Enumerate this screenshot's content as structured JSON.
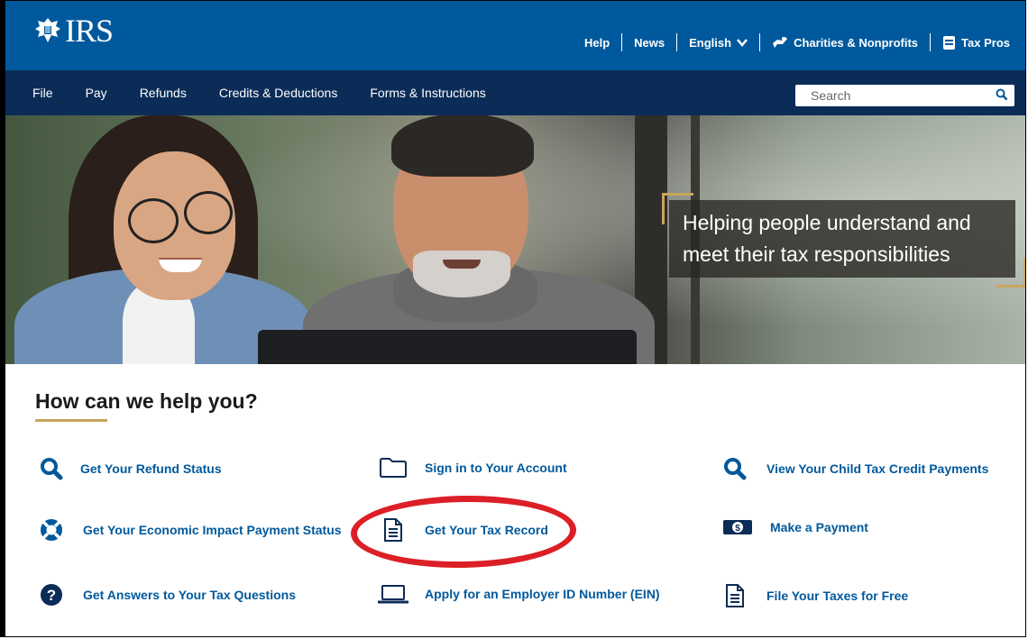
{
  "brand": {
    "wordmark": "IRS"
  },
  "utility_nav": {
    "help": "Help",
    "news": "News",
    "language": "English",
    "charities": "Charities & Nonprofits",
    "tax_pros": "Tax Pros"
  },
  "main_nav": {
    "items": [
      "File",
      "Pay",
      "Refunds",
      "Credits & Deductions",
      "Forms & Instructions"
    ]
  },
  "search": {
    "placeholder": "Search"
  },
  "hero": {
    "tagline_line1": "Helping people understand and",
    "tagline_line2": "meet their tax responsibilities"
  },
  "help_section": {
    "heading": "How can we help you?",
    "tasks": [
      {
        "label": "Get Your Refund Status",
        "icon": "search-icon"
      },
      {
        "label": "Sign in to Your Account",
        "icon": "folder-icon"
      },
      {
        "label": "View Your Child Tax Credit Payments",
        "icon": "search-icon"
      },
      {
        "label": "Get Your Economic Impact Payment Status",
        "icon": "lifebuoy-icon"
      },
      {
        "label": "Get Your Tax Record",
        "icon": "document-icon"
      },
      {
        "label": "Make a Payment",
        "icon": "cash-icon"
      },
      {
        "label": "Get Answers to Your Tax Questions",
        "icon": "question-icon"
      },
      {
        "label": "Apply for an Employer ID Number (EIN)",
        "icon": "laptop-icon"
      },
      {
        "label": "File Your Taxes for Free",
        "icon": "document-icon"
      }
    ]
  },
  "colors": {
    "top_bar": "#00599c",
    "main_nav": "#0b2c57",
    "link": "#00599c",
    "accent_gold": "#c9a55c",
    "annotation_red": "#dc1f26"
  }
}
